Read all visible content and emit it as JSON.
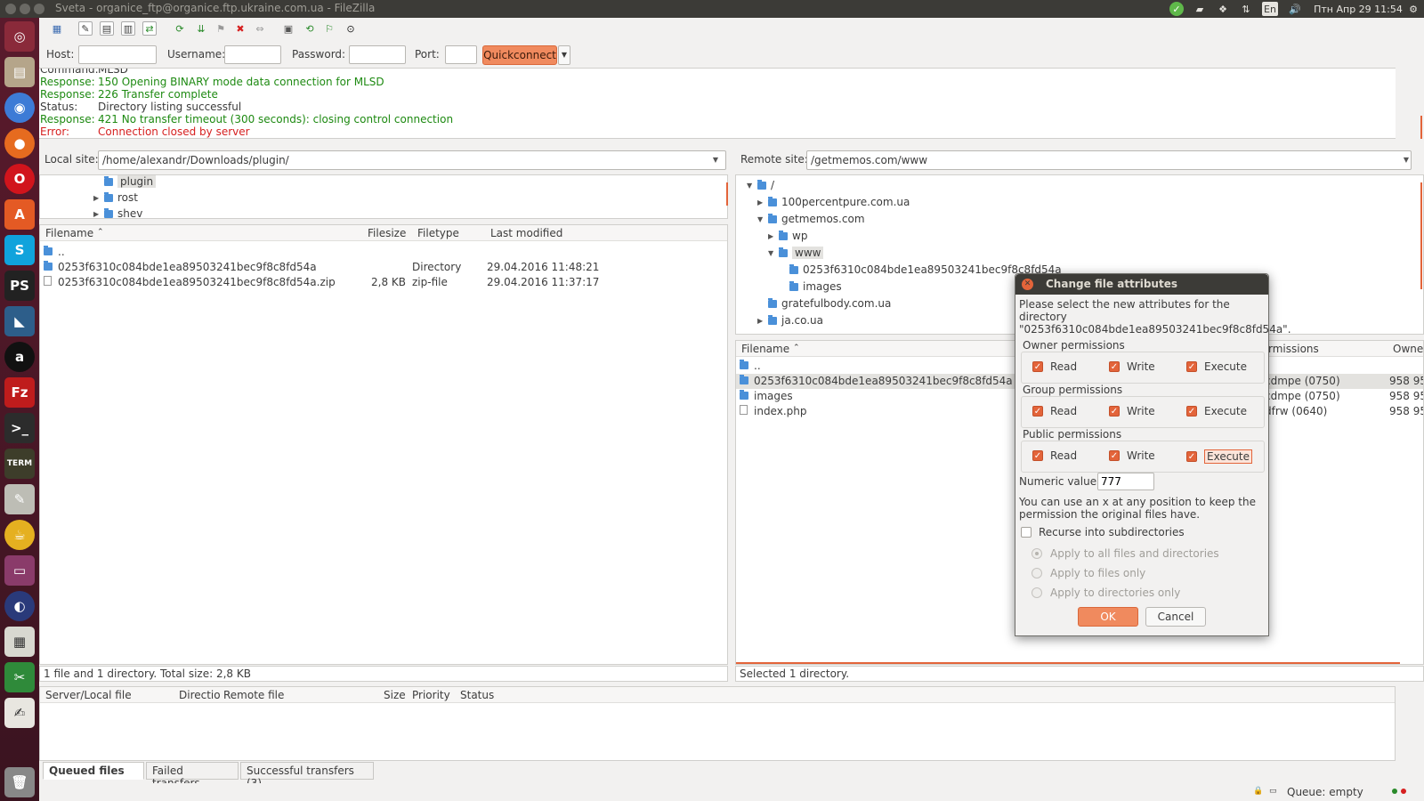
{
  "window": {
    "title": "Sveta - organice_ftp@organice.ftp.ukraine.com.ua - FileZilla"
  },
  "panel": {
    "clock": "Птн Апр 29 11:54",
    "keyboard": "En"
  },
  "quickconnect": {
    "host_label": "Host:",
    "user_label": "Username:",
    "pass_label": "Password:",
    "port_label": "Port:",
    "button": "Quickconnect",
    "host": "",
    "user": "",
    "pass": "",
    "port": ""
  },
  "log": [
    {
      "k": "Command:",
      "v": "MLSD",
      "type": "normal"
    },
    {
      "k": "Response:",
      "v": "150 Opening BINARY mode data connection for MLSD",
      "type": "green"
    },
    {
      "k": "Response:",
      "v": "226 Transfer complete",
      "type": "green"
    },
    {
      "k": "Status:",
      "v": "Directory listing successful",
      "type": "normal"
    },
    {
      "k": "Response:",
      "v": "421 No transfer timeout (300 seconds): closing control connection",
      "type": "green"
    },
    {
      "k": "Error:",
      "v": "Connection closed by server",
      "type": "red"
    }
  ],
  "local": {
    "label": "Local site:",
    "path": "/home/alexandr/Downloads/plugin/",
    "tree": [
      "plugin",
      "rost",
      "shev"
    ],
    "columns": [
      "Filename",
      "Filesize",
      "Filetype",
      "Last modified"
    ],
    "files": [
      {
        "name": "..",
        "size": "",
        "type": "",
        "modified": "",
        "dir": true
      },
      {
        "name": "0253f6310c084bde1ea89503241bec9f8c8fd54a",
        "size": "",
        "type": "Directory",
        "modified": "29.04.2016 11:48:21",
        "dir": true
      },
      {
        "name": "0253f6310c084bde1ea89503241bec9f8c8fd54a.zip",
        "size": "2,8 KB",
        "type": "zip-file",
        "modified": "29.04.2016 11:37:17",
        "dir": false
      }
    ],
    "status": "1 file and 1 directory. Total size: 2,8 KB"
  },
  "remote": {
    "label": "Remote site:",
    "path": "/getmemos.com/www",
    "tree": [
      "/",
      "100percentpure.com.ua",
      "getmemos.com",
      "wp",
      "www",
      "0253f6310c084bde1ea89503241bec9f8c8fd54a",
      "images",
      "gratefulbody.com.ua",
      "ja.co.ua"
    ],
    "columns": [
      "Filename",
      "rmissions",
      "Owne"
    ],
    "files": [
      {
        "name": "..",
        "perm": "",
        "owner": "",
        "dir": true
      },
      {
        "name": "0253f6310c084bde1ea89503241bec9f8c8fd54a",
        "perm": "cdmpe (0750)",
        "owner": "958 95",
        "dir": true
      },
      {
        "name": "images",
        "perm": "cdmpe (0750)",
        "owner": "958 95",
        "dir": true
      },
      {
        "name": "index.php",
        "perm": "dfrw (0640)",
        "owner": "958 95",
        "dir": false
      }
    ],
    "status": "Selected 1 directory."
  },
  "queue": {
    "columns": [
      "Server/Local file",
      "Directio",
      "Remote file",
      "Size",
      "Priority",
      "Status"
    ],
    "tabs": [
      "Queued files",
      "Failed transfers",
      "Successful transfers (3)"
    ],
    "status": "Queue: empty"
  },
  "dialog": {
    "title": "Change file attributes",
    "intro1": "Please select the new attributes for the",
    "intro2": "directory",
    "intro3": "\"0253f6310c084bde1ea89503241bec9f8c8fd54a\".",
    "groups": [
      {
        "label": "Owner permissions",
        "read": "Read",
        "write": "Write",
        "execute": "Execute"
      },
      {
        "label": "Group permissions",
        "read": "Read",
        "write": "Write",
        "execute": "Execute"
      },
      {
        "label": "Public permissions",
        "read": "Read",
        "write": "Write",
        "execute": "Execute"
      }
    ],
    "numeric_label": "Numeric value:",
    "numeric_value": "777",
    "hint1": "You can use an x at any position to keep the",
    "hint2": "permission the original files have.",
    "recurse": "Recurse into subdirectories",
    "apply_all": "Apply to all files and directories",
    "apply_files": "Apply to files only",
    "apply_dirs": "Apply to directories only",
    "ok": "OK",
    "cancel": "Cancel"
  },
  "colors": {
    "accent": "#e3643a",
    "log_green": "#1e8a12",
    "log_red": "#d62020",
    "folder": "#4a90d9"
  }
}
